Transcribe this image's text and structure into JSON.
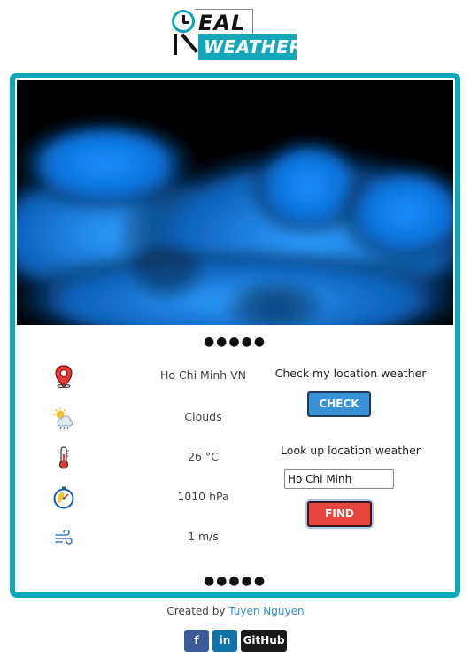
{
  "logo": {
    "letters_top": "EAL",
    "letters_bottom": "WEATHER"
  },
  "separator_dots": "●●●●●",
  "weather": {
    "location": "Ho Chi Minh VN",
    "condition": "Clouds",
    "temperature": "26 °C",
    "pressure": "1010 hPa",
    "wind": "1 m/s"
  },
  "check_panel": {
    "title": "Check my location weather",
    "button": "CHECK"
  },
  "lookup_panel": {
    "title": "Look up location weather",
    "input_value": "Ho Chi Minh",
    "button": "FIND"
  },
  "footer": {
    "prefix": "Created by",
    "author": "Tuyen Nguyen",
    "social": {
      "facebook": "f",
      "linkedin": "in",
      "github": "GitHub"
    }
  },
  "colors": {
    "accent": "#0aa8ba",
    "check": "#3691d6",
    "find": "#e8453c",
    "link": "#2d8fd4"
  }
}
